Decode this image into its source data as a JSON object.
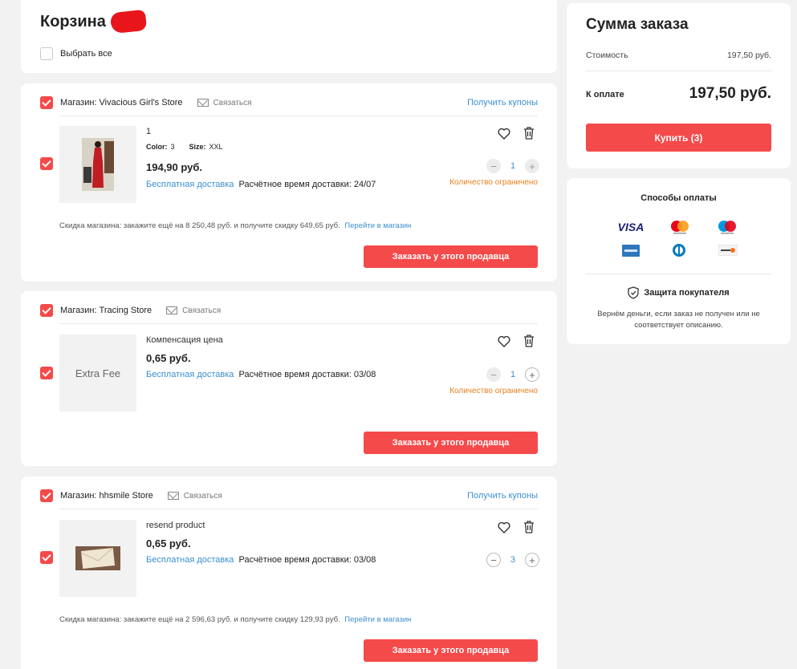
{
  "cart": {
    "title": "Корзина",
    "select_all": "Выбрать все"
  },
  "stores": [
    {
      "store_label": "Магазин: Vivacious Girl's Store",
      "contact": "Связаться",
      "coupons": "Получить купоны",
      "item": {
        "name": "1",
        "color_label": "Color:",
        "color_value": "3",
        "size_label": "Size:",
        "size_value": "XXL",
        "price": "194,90 руб.",
        "free_shipping": "Бесплатная доставка",
        "delivery": "Расчётное время доставки: 24/07",
        "qty": "1",
        "limited": "Количество ограничено"
      },
      "discount_text": "Скидка магазина: закажите ещё на 8 250,48 руб. и получите скидку 649,65 руб.",
      "discount_link": "Перейти в магазин",
      "order_button": "Заказать у этого продавца"
    },
    {
      "store_label": "Магазин: Tracing Store",
      "contact": "Связаться",
      "item": {
        "thumb_text": "Extra Fee",
        "name": "Компенсация цена",
        "price": "0,65 руб.",
        "free_shipping": "Бесплатная доставка",
        "delivery": "Расчётное время доставки: 03/08",
        "qty": "1",
        "limited": "Количество ограничено"
      },
      "order_button": "Заказать у этого продавца"
    },
    {
      "store_label": "Магазин: hhsmile Store",
      "contact": "Связаться",
      "coupons": "Получить купоны",
      "item": {
        "name": "resend product",
        "price": "0,65 руб.",
        "free_shipping": "Бесплатная доставка",
        "delivery": "Расчётное время доставки: 03/08",
        "qty": "3"
      },
      "discount_text": "Скидка магазина: закажите ещё на 2 596,63 руб. и получите скидку 129,93 руб.",
      "discount_link": "Перейти в магазин",
      "order_button": "Заказать у этого продавца"
    }
  ],
  "summary": {
    "title": "Сумма заказа",
    "cost_label": "Стоимость",
    "cost_value": "197,50 руб.",
    "pay_label": "К оплате",
    "pay_value": "197,50 руб.",
    "buy_button": "Купить (3)"
  },
  "payment": {
    "title": "Способы оплаты",
    "visa": "VISA",
    "protection_title": "Защита покупателя",
    "protection_text_1": "Вернём деньги, если заказ не получен или не",
    "protection_text_2": "соответствует описанию."
  },
  "colors": {
    "accent": "#f44a4a",
    "link": "#3b8fd0",
    "warning": "#e8801c"
  }
}
